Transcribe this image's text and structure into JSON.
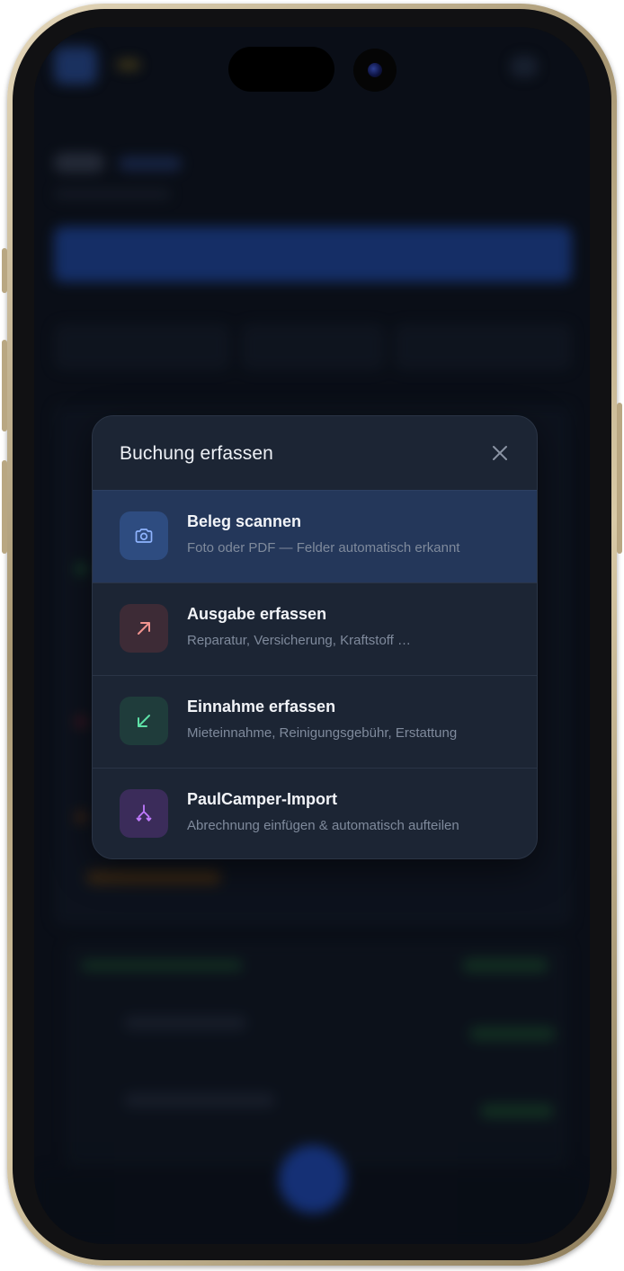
{
  "dialog": {
    "title": "Buchung erfassen",
    "close_icon": "close-icon"
  },
  "options": [
    {
      "title": "Beleg scannen",
      "subtitle": "Foto oder PDF — Felder automatisch erkannt",
      "icon": "camera-icon",
      "icon_color": "#8fb4ff",
      "icon_bg": "#2e4c80",
      "selected": true
    },
    {
      "title": "Ausgabe erfassen",
      "subtitle": "Reparatur, Versicherung, Kraftstoff …",
      "icon": "arrow-up-right-icon",
      "icon_color": "#f1948f",
      "icon_bg": "#3d2b36",
      "selected": false
    },
    {
      "title": "Einnahme erfassen",
      "subtitle": "Mieteinnahme, Reinigungsgebühr, Erstattung",
      "icon": "arrow-down-left-icon",
      "icon_color": "#5ee0a6",
      "icon_bg": "#1f3c3b",
      "selected": false
    },
    {
      "title": "PaulCamper-Import",
      "subtitle": "Abrechnung einfügen & automatisch aufteilen",
      "icon": "split-arrows-icon",
      "icon_color": "#c17bff",
      "icon_bg": "#3b2c5a",
      "selected": false
    }
  ],
  "colors": {
    "modal_bg": "#1c2534",
    "selected_row_bg": "#24375a",
    "phone_frame": "#c9b78f"
  }
}
